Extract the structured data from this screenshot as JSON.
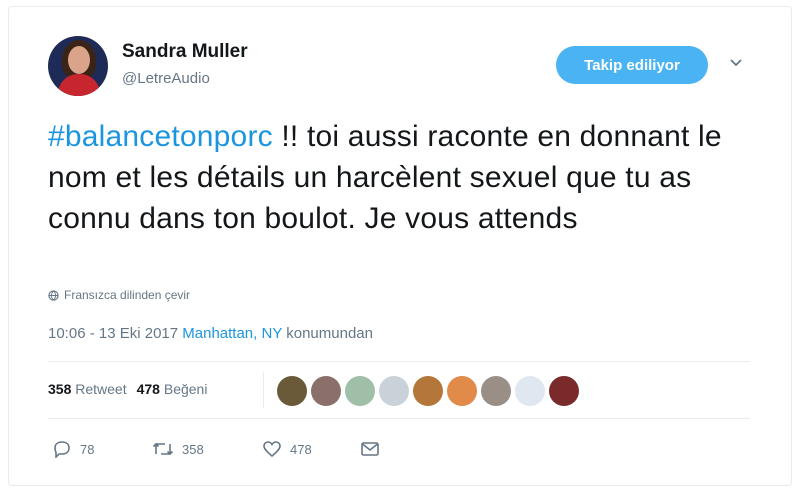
{
  "user": {
    "name": "Sandra Muller",
    "handle": "@LetreAudio"
  },
  "follow_button": "Takip ediliyor",
  "tweet": {
    "hashtag": "#balancetonporc",
    "text_rest": " !!  toi aussi raconte en donnant le nom et les détails un harcèlent sexuel que tu as connu dans ton boulot. Je vous attends"
  },
  "translate_label": "Fransızca dilinden çevir",
  "meta": {
    "timestamp": "10:06 - 13 Eki 2017",
    "location": "Manhattan, NY",
    "suffix": "konumundan"
  },
  "stats": {
    "retweet_count": "358",
    "retweet_label": "Retweet",
    "like_count": "478",
    "like_label": "Beğeni"
  },
  "liker_colors": [
    "#6b5a3a",
    "#8a6f6a",
    "#9fbfa8",
    "#c9d2d9",
    "#b5763a",
    "#e28a4a",
    "#9a8f86",
    "#dfe7f0",
    "#7a2a2a"
  ],
  "actions": {
    "reply_count": "78",
    "retweet_count": "358",
    "like_count": "478"
  }
}
